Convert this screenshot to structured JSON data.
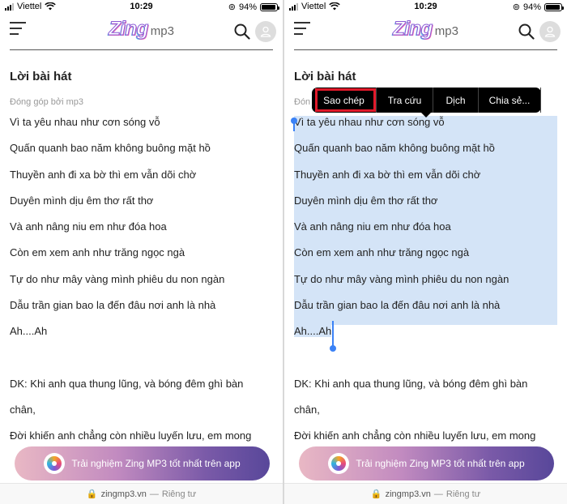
{
  "status": {
    "carrier": "Viettel",
    "time": "10:29",
    "battery": "94%"
  },
  "header": {
    "logo_main": "Zing",
    "logo_sub": "mp3"
  },
  "page": {
    "title": "Lời bài hát",
    "contributor": "Đóng góp bởi  mp3",
    "contributor_short": "Đón",
    "lyrics": [
      "Vì ta yêu nhau như cơn sóng vỗ",
      "Quấn quanh bao năm không buông mặt hồ",
      "Thuyền anh đi xa bờ thì em vẫn dõi chờ",
      "Duyên mình dịu êm thơ rất thơ",
      "Và anh nâng niu em như đóa hoa",
      "Còn em xem anh như trăng ngọc ngà",
      "Tự do như mây vàng mình phiêu du non ngàn",
      "Dẫu trần gian bao la đến đâu nơi anh là nhà",
      "Ah....Ah"
    ],
    "chorus": [
      "DK: Khi anh qua thung lũng, và bóng đêm ghì bàn",
      "chân,",
      "Đời khiến anh chẳng còn nhiều luyến lưu, em mong"
    ]
  },
  "cta": {
    "label": "Trải nghiệm Zing MP3 tốt nhất trên app"
  },
  "url_bar": {
    "domain": "zingmp3.vn",
    "separator": "—",
    "privacy": "Riêng tư"
  },
  "context_menu": {
    "items": [
      "Sao chép",
      "Tra cứu",
      "Dịch",
      "Chia sẻ..."
    ]
  },
  "colors": {
    "selection": "#d4e4f7",
    "handle": "#3b82f6",
    "highlight_box": "#e0192a"
  }
}
